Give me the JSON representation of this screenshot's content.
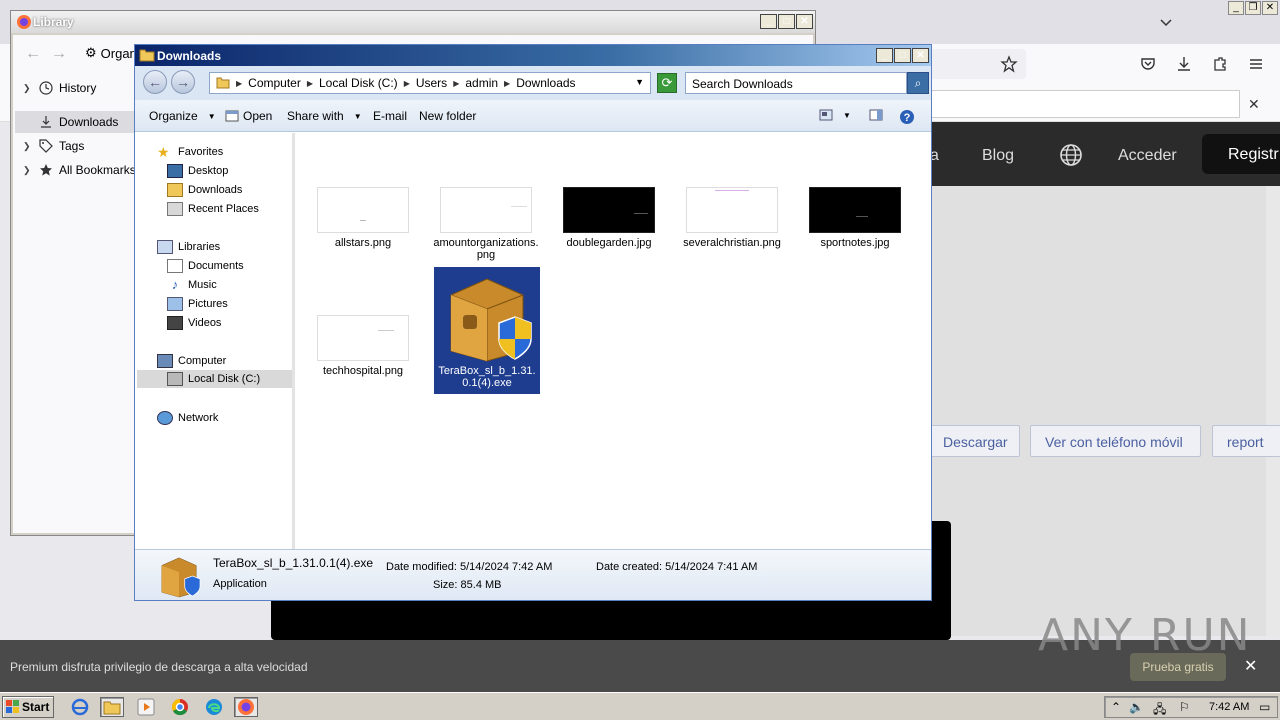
{
  "browser": {
    "site_nav": [
      "a",
      "Blog"
    ],
    "acceder": "Acceder",
    "registro": "Registr",
    "site_buttons": [
      "Descargar",
      "Ver con teléfono móvil",
      "report"
    ],
    "promo_text": "Premium disfruta privilegio de descarga a alta velocidad",
    "promo_button": "Prueba gratis",
    "watermark": "ANY RUN"
  },
  "library": {
    "title": "Library",
    "organize": "Organ",
    "items": [
      {
        "label": "History",
        "icon": "clock-icon"
      },
      {
        "label": "Downloads",
        "icon": "download-icon"
      },
      {
        "label": "Tags",
        "icon": "tag-icon"
      },
      {
        "label": "All Bookmarks",
        "icon": "star-icon"
      }
    ]
  },
  "explorer": {
    "title": "Downloads",
    "breadcrumb": [
      "Computer",
      "Local Disk (C:)",
      "Users",
      "admin",
      "Downloads"
    ],
    "search_placeholder": "Search Downloads",
    "commands": [
      "Organize",
      "Open",
      "Share with",
      "E-mail",
      "New folder"
    ],
    "nav": {
      "favorites": {
        "label": "Favorites",
        "items": [
          "Desktop",
          "Downloads",
          "Recent Places"
        ]
      },
      "libraries": {
        "label": "Libraries",
        "items": [
          "Documents",
          "Music",
          "Pictures",
          "Videos"
        ]
      },
      "computer": {
        "label": "Computer",
        "items": [
          "Local Disk (C:)"
        ]
      },
      "network": "Network"
    },
    "files": [
      {
        "name": "allstars.png",
        "thumb": "white"
      },
      {
        "name": "amountorganizations.png",
        "thumb": "white"
      },
      {
        "name": "doublegarden.jpg",
        "thumb": "black"
      },
      {
        "name": "severalchristian.png",
        "thumb": "white"
      },
      {
        "name": "sportnotes.jpg",
        "thumb": "black"
      },
      {
        "name": "techhospital.png",
        "thumb": "white"
      },
      {
        "name": "TeraBox_sl_b_1.31.0.1(4).exe",
        "thumb": "box",
        "selected": true
      }
    ],
    "details": {
      "name": "TeraBox_sl_b_1.31.0.1(4).exe",
      "type": "Application",
      "modified_label": "Date modified:",
      "modified": "5/14/2024 7:42 AM",
      "size_label": "Size:",
      "size": "85.4 MB",
      "created_label": "Date created:",
      "created": "5/14/2024 7:41 AM"
    }
  },
  "taskbar": {
    "start": "Start",
    "clock": "7:42 AM"
  }
}
